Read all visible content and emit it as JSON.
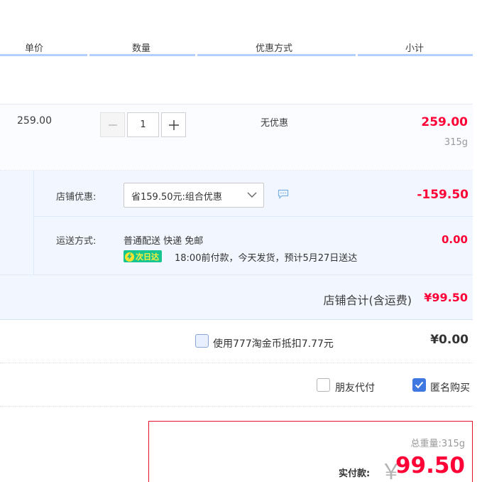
{
  "header": {
    "col_price": "单价",
    "col_qty": "数量",
    "col_promo": "优惠方式",
    "col_subtotal": "小计"
  },
  "item": {
    "price": "259.00",
    "quantity": "1",
    "promo": "无优惠",
    "subtotal": "259.00",
    "weight": "315g"
  },
  "shop": {
    "discount_label": "店铺优惠:",
    "discount_select": "省159.50元:组合优惠",
    "discount_amount": "-159.50",
    "shipping_label": "运送方式:",
    "shipping_method": "普通配送 快递 免邮",
    "shipping_badge": "次日达",
    "shipping_note": "18:00前付款，今天发货，预计5月27日送达",
    "shipping_fee": "0.00",
    "total_label": "店铺合计(含运费)",
    "total_amount": "¥99.50"
  },
  "coins": {
    "label": "使用777淘金币抵扣7.77元",
    "amount": "¥0.00",
    "checked": false
  },
  "options": {
    "friend_pay": "朋友代付",
    "anonymous": "匿名购买",
    "friend_pay_checked": false,
    "anonymous_checked": true
  },
  "summary": {
    "weight_label": "总重量:",
    "weight": "315g",
    "pay_label": "实付款:",
    "currency": "￥",
    "pay_amount": "99.50"
  },
  "colors": {
    "accent_red": "#ff0036",
    "header_bar": "#b2d1ff",
    "section_bg": "#f2f7ff",
    "badge_green": "#16c68f",
    "checkbox_blue": "#3f78e0"
  },
  "icons": [
    "minus-icon",
    "plus-icon",
    "chevron-down-icon",
    "chat-icon",
    "bolt-icon",
    "check-icon"
  ]
}
